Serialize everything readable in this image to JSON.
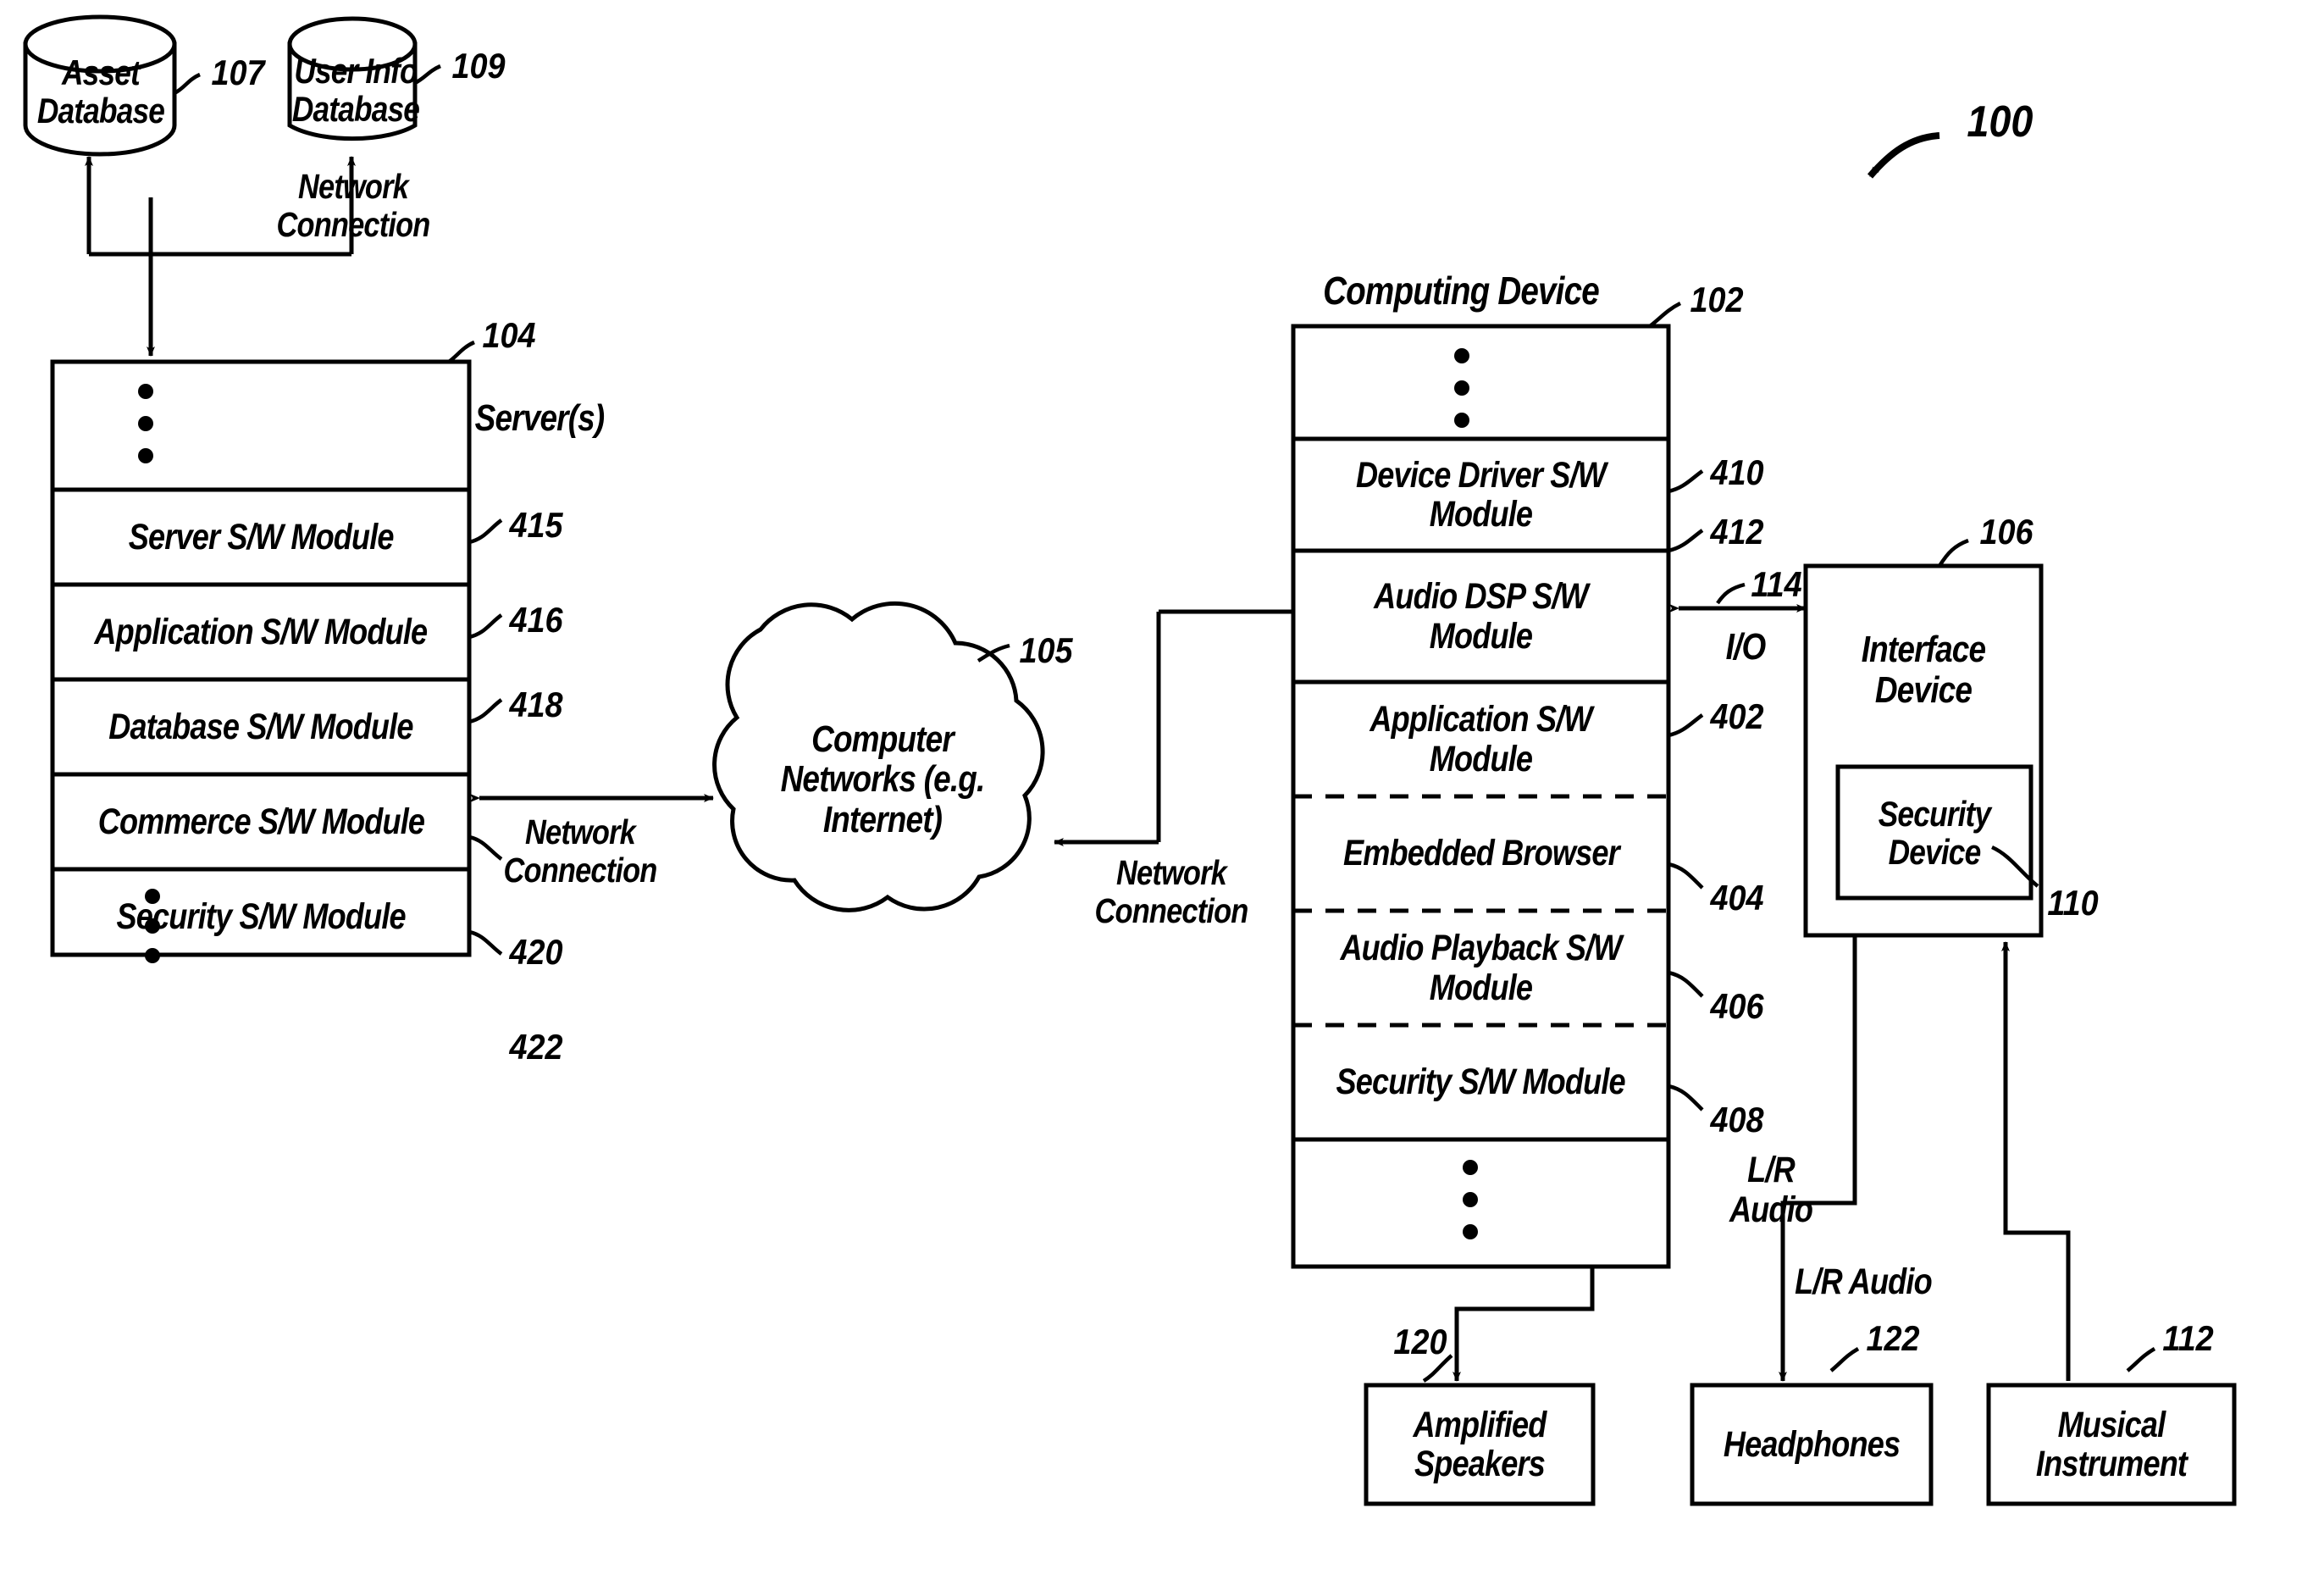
{
  "figure": {
    "number": "100"
  },
  "databases": [
    {
      "name": "asset_database",
      "label": "Asset\nDatabase",
      "ref": "107"
    },
    {
      "name": "user_info_database",
      "label": "User Info\nDatabase",
      "ref": "109"
    }
  ],
  "server": {
    "title": "Server(s)",
    "ref": "104",
    "ellipsis_top": "•\n•\n•",
    "ellipsis_bottom": "•\n•\n•",
    "modules": [
      {
        "label": "Server S/W\nModule",
        "ref": "415"
      },
      {
        "label": "Application S/W\nModule",
        "ref": "416"
      },
      {
        "label": "Database S/W\nModule",
        "ref": "418"
      },
      {
        "label": "Commerce S/W\nModule",
        "ref": "420"
      },
      {
        "label": "Security S/W\nModule",
        "ref": "422"
      }
    ]
  },
  "cloud": {
    "label": "Computer\nNetworks\n(e.g. Internet)",
    "ref": "105"
  },
  "computing_device": {
    "title": "Computing Device",
    "ref": "102",
    "ellipsis_top": "•\n•\n•",
    "ellipsis_bottom": "•\n•\n•",
    "modules": [
      {
        "label": "Device Driver\nS/W Module",
        "ref": "410"
      },
      {
        "label": "Audio DSP\nS/W Module",
        "ref": "412"
      },
      {
        "label": "Application S/W\nModule",
        "ref": "402"
      },
      {
        "label": "Embedded\nBrowser",
        "ref": "404"
      },
      {
        "label": "Audio Playback\nS/W Module",
        "ref": "406"
      },
      {
        "label": "Security S/W\nModule",
        "ref": "408"
      }
    ]
  },
  "interface_device": {
    "label": "Interface\nDevice",
    "ref": "106",
    "security_device": {
      "label": "Security\nDevice",
      "ref": "110"
    }
  },
  "peripherals": [
    {
      "label": "Amplified\nSpeakers",
      "ref": "120"
    },
    {
      "label": "Headphones",
      "ref": "122"
    },
    {
      "label": "Musical\nInstrument",
      "ref": "112"
    }
  ],
  "connection_labels": {
    "network_connection_db": "Network\nConnection",
    "network_connection_server": "Network\nConnection",
    "network_connection_device": "Network\nConnection",
    "io": "I/O",
    "io_ref": "114",
    "lr_audio_left": "L/R\nAudio",
    "lr_audio_right": "L/R Audio"
  }
}
